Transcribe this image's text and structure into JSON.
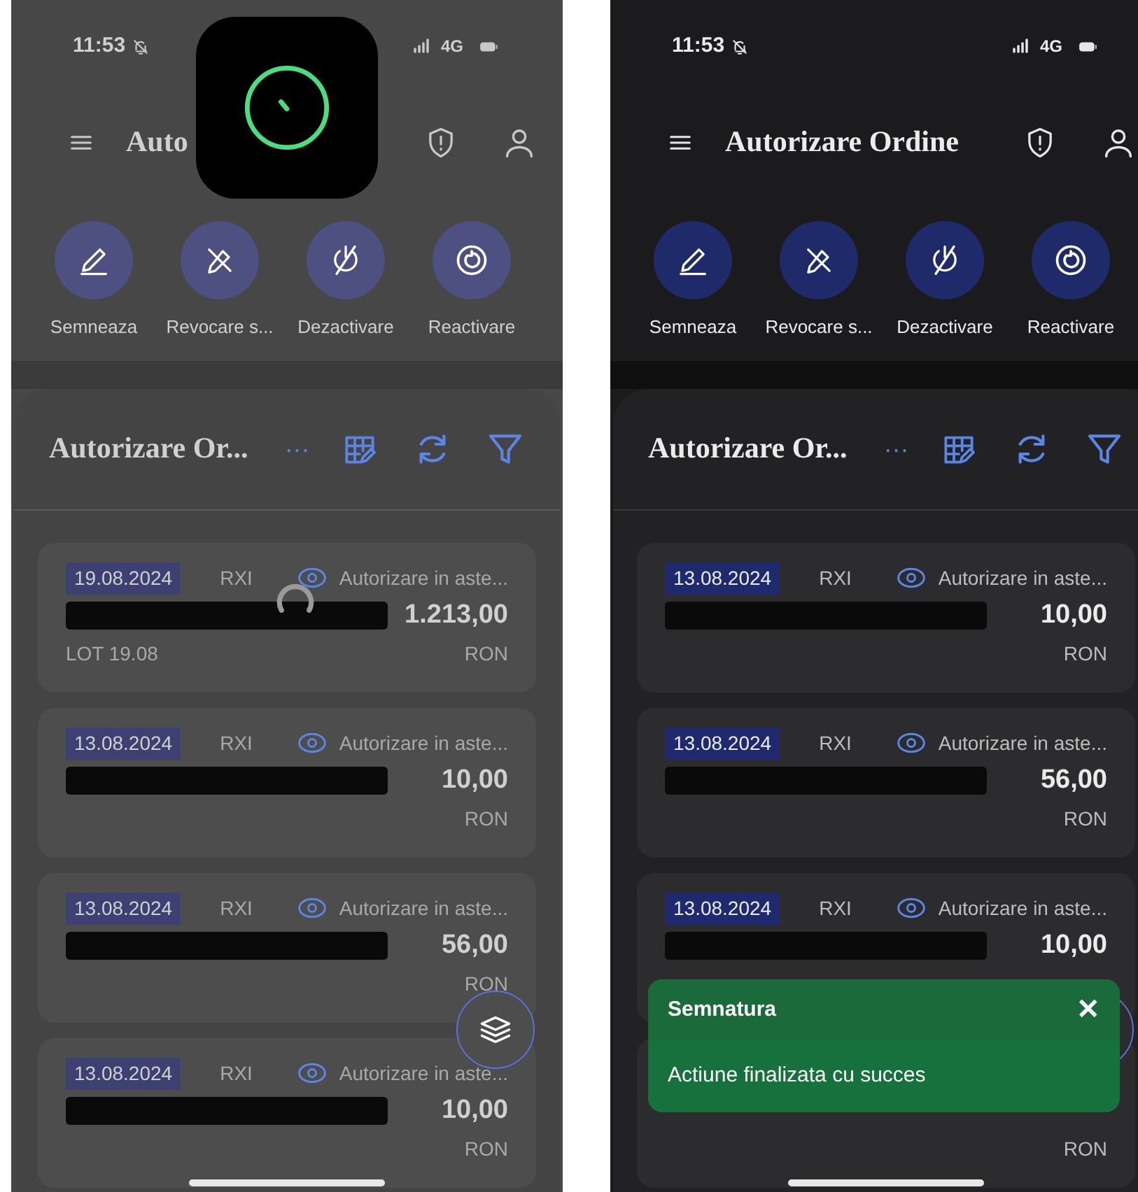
{
  "screens": [
    {
      "loading": true,
      "status_bar": {
        "time": "11:53",
        "network": "4G"
      },
      "header": {
        "title": "Auto"
      },
      "actions": [
        {
          "label": "Semneaza"
        },
        {
          "label": "Revocare s..."
        },
        {
          "label": "Dezactivare"
        },
        {
          "label": "Reactivare"
        }
      ],
      "panel": {
        "title": "Autorizare Or...",
        "more": "···"
      },
      "orders": [
        {
          "date": "19.08.2024",
          "code": "RXI",
          "status": "Autorizare in aste...",
          "amount": "1.213,00",
          "note": "LOT 19.08",
          "currency": "RON"
        },
        {
          "date": "13.08.2024",
          "code": "RXI",
          "status": "Autorizare in aste...",
          "amount": "10,00",
          "currency": "RON"
        },
        {
          "date": "13.08.2024",
          "code": "RXI",
          "status": "Autorizare in aste...",
          "amount": "56,00",
          "currency": "RON"
        },
        {
          "date": "13.08.2024",
          "code": "RXI",
          "status": "Autorizare in aste...",
          "amount": "10,00",
          "currency": "RON"
        }
      ],
      "fab": true
    },
    {
      "loading": false,
      "status_bar": {
        "time": "11:53",
        "network": "4G"
      },
      "header": {
        "title": "Autorizare Ordine"
      },
      "actions": [
        {
          "label": "Semneaza"
        },
        {
          "label": "Revocare s..."
        },
        {
          "label": "Dezactivare"
        },
        {
          "label": "Reactivare"
        }
      ],
      "panel": {
        "title": "Autorizare Or...",
        "more": "···"
      },
      "orders": [
        {
          "date": "13.08.2024",
          "code": "RXI",
          "status": "Autorizare in aste...",
          "amount": "10,00",
          "currency": "RON"
        },
        {
          "date": "13.08.2024",
          "code": "RXI",
          "status": "Autorizare in aste...",
          "amount": "56,00",
          "currency": "RON"
        },
        {
          "date": "13.08.2024",
          "code": "RXI",
          "status": "Autorizare in aste...",
          "amount": "10,00"
        },
        {
          "currency": "RON"
        }
      ],
      "fab": true,
      "toast": {
        "title": "Semnatura",
        "close": "✕",
        "message": "Actiune finalizata cu succes"
      }
    }
  ]
}
